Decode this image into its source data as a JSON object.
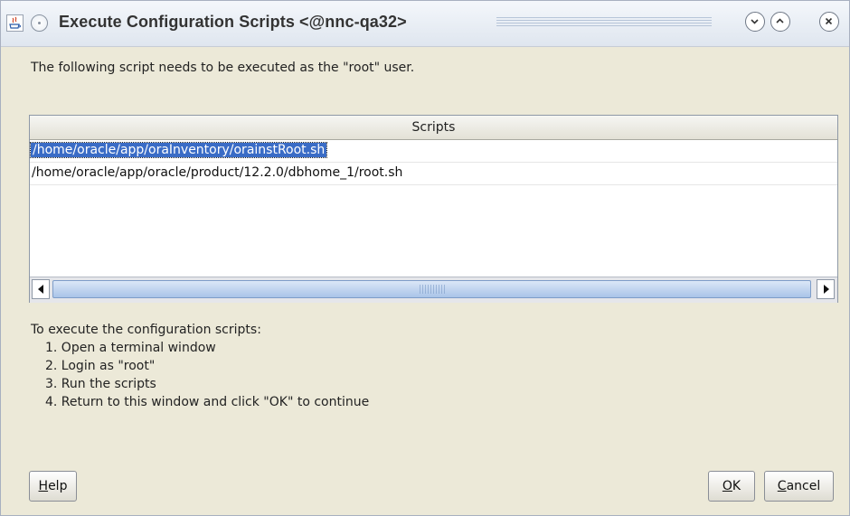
{
  "window": {
    "title": "Execute Configuration Scripts <@nnc-qa32>"
  },
  "titlebar_icons": {
    "app": "java-icon",
    "menu": "window-menu-icon",
    "minimize": "minimize-icon",
    "maximize": "maximize-icon",
    "close": "close-icon"
  },
  "instruction": "The following script needs to be executed as the \"root\" user.",
  "scripts_table": {
    "header": "Scripts",
    "rows": [
      "/home/oracle/app/oraInventory/orainstRoot.sh",
      "/home/oracle/app/oracle/product/12.2.0/dbhome_1/root.sh"
    ],
    "selected_row": 0
  },
  "steps": {
    "intro": "To execute the configuration scripts:",
    "items": [
      "1. Open a terminal window",
      "2. Login as \"root\"",
      "3. Run the scripts",
      "4. Return to this window and click \"OK\" to continue"
    ]
  },
  "buttons": {
    "help": {
      "mnemonic": "H",
      "rest": "elp"
    },
    "ok": {
      "mnemonic": "O",
      "rest": "K"
    },
    "cancel": {
      "mnemonic": "C",
      "rest": "ancel"
    }
  },
  "colors": {
    "selection": "#3a6cc6",
    "dialog_bg": "#ece9d8"
  }
}
